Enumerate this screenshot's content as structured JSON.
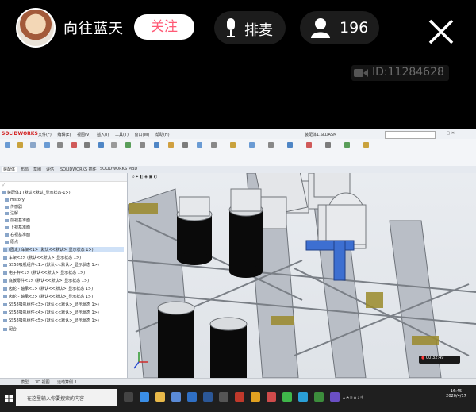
{
  "stream": {
    "host_name": "向往蓝天",
    "follow_label": "关注",
    "mic_label": "排麦",
    "viewer_count": "196",
    "room_id": "ID:11284628"
  },
  "solidworks": {
    "logo": "SOLIDWORKS",
    "menus": [
      "文件(F)",
      "编辑(E)",
      "视图(V)",
      "插入(I)",
      "工具(T)",
      "窗口(W)",
      "帮助(H)"
    ],
    "doc_title": "装配体1.SLDASM",
    "command_tabs": [
      "装配体",
      "布局",
      "草图",
      "评估",
      "SOLIDWORKS 插件",
      "SOLIDWORKS MBD"
    ],
    "tree": [
      "装配体1 (默认<默认_显示状态-1>)",
      "History",
      "传感器",
      "注解",
      "前视基准面",
      "上视基准面",
      "右视基准面",
      "原点",
      "(固定) 车架<1> (默认<<默认>_显示状态 1>)",
      "车架<2> (默认<<默认>_显示状态 1>)",
      "SS58吸机组件<1> (默认<<默认>_显示状态 1>)",
      "电子秤<1> (默认<<默认>_显示状态 1>)",
      "底板零件<1> (默认<<默认>_显示状态 1>)",
      "齿轮 - 轴承<1> (默认<<默认>_显示状态 1>)",
      "齿轮 - 轴承<2> (默认<<默认>_显示状态 1>)",
      "SS58吸机组件<3> (默认<<默认>_显示状态 1>)",
      "SS58吸机组件<4> (默认<<默认>_显示状态 1>)",
      "SS58吸机组件<5> (默认<<默认>_显示状态 1>)",
      "配合"
    ],
    "bottom_tabs": [
      "模型",
      "3D 视图",
      "运动算例 1"
    ],
    "taskbar_search": "在这里输入你要搜索的内容",
    "clock_time": "16:45",
    "clock_date": "2020/4/17",
    "recording": "00:32:49"
  },
  "colors": {
    "follow_text": "#ff5a76",
    "pill_bg": "#1c1c1c",
    "tree_selection": "#cfe1f7"
  }
}
